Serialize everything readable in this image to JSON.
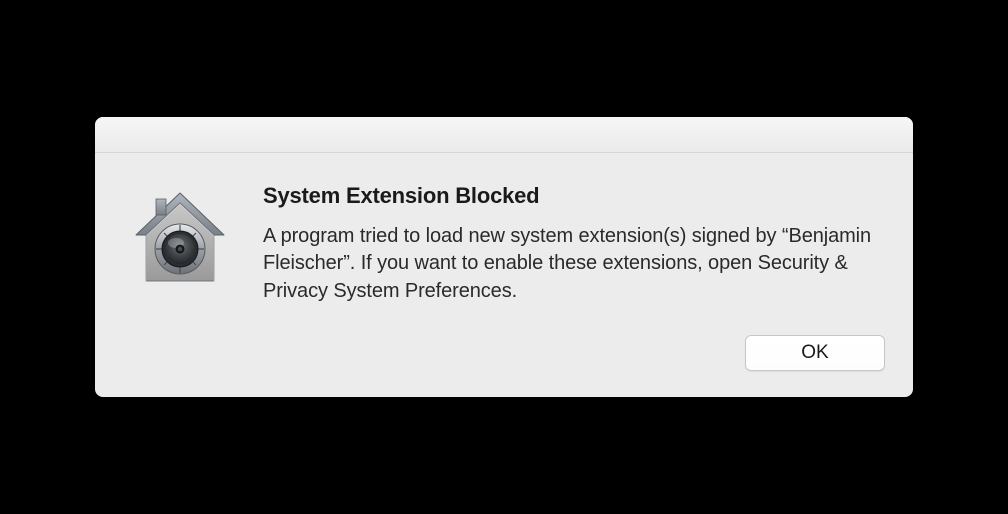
{
  "dialog": {
    "title": "System Extension Blocked",
    "message": "A program tried to load new system extension(s) signed by “Benjamin Fleischer”.  If you want to enable these extensions, open Security & Privacy System Preferences.",
    "ok_label": "OK",
    "icon_name": "security-house-icon"
  }
}
